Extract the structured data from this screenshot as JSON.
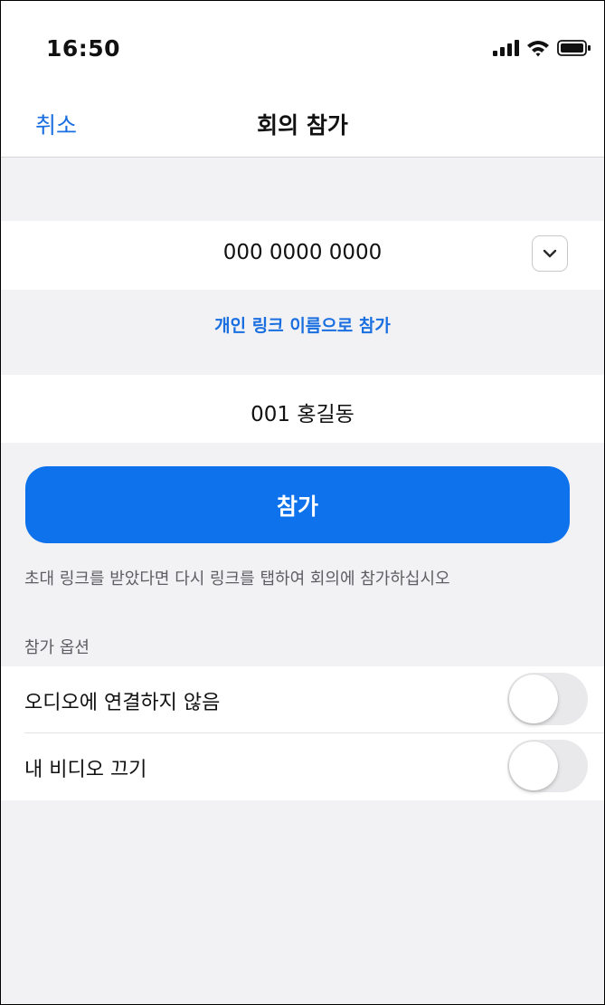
{
  "status_bar": {
    "time": "16:50",
    "icons": [
      "signal-icon",
      "wifi-icon",
      "battery-icon"
    ]
  },
  "nav": {
    "cancel_label": "취소",
    "title": "회의 참가"
  },
  "meeting_id": {
    "value": "000 0000 0000",
    "dropdown_icon": "chevron-down-icon"
  },
  "personal_link_label": "개인 링크 이름으로 참가",
  "display_name": {
    "value": "001 홍길동"
  },
  "join_button_label": "참가",
  "hint_text": "초대 링크를 받았다면 다시 링크를 탭하여 회의에 참가하십시오",
  "options": {
    "section_label": "참가 옵션",
    "items": [
      {
        "label": "오디오에 연결하지 않음",
        "enabled": false
      },
      {
        "label": "내 비디오 끄기",
        "enabled": false
      }
    ]
  },
  "colors": {
    "accent": "#0e72ed",
    "link": "#1a6fe0",
    "background": "#f2f2f4"
  }
}
